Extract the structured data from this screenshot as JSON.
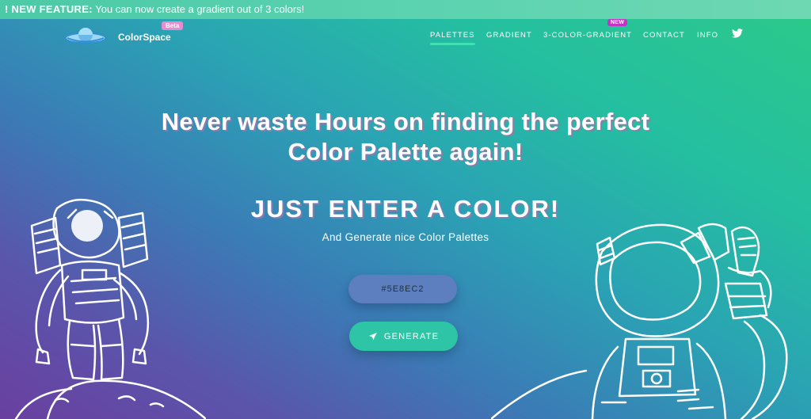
{
  "banner": {
    "prefix": "! NEW FEATURE:",
    "message": "You can now create a gradient out of 3 colors!"
  },
  "brand": {
    "name": "ColorSpace",
    "badge": "Beta"
  },
  "nav": {
    "items": [
      {
        "label": "PALETTES",
        "active": true
      },
      {
        "label": "GRADIENT"
      },
      {
        "label": "3-COLOR-GRADIENT",
        "badge": "NEW"
      },
      {
        "label": "CONTACT"
      },
      {
        "label": "INFO"
      }
    ],
    "social_icon": "twitter-icon"
  },
  "hero": {
    "headline_line1": "Never waste Hours on finding the perfect",
    "headline_line2": "Color Palette again!",
    "subhead": "JUST ENTER A COLOR!",
    "tagline": "And Generate nice Color Palettes"
  },
  "form": {
    "color_value": "#5E8EC2",
    "generate_label": "GENERATE",
    "generate_icon": "rocket-icon"
  },
  "colors": {
    "accent": "#2dc5a6",
    "beta_badge": "#e88bd0",
    "new_badge": "#c631c8",
    "input_bg": "#5d7fbf"
  }
}
